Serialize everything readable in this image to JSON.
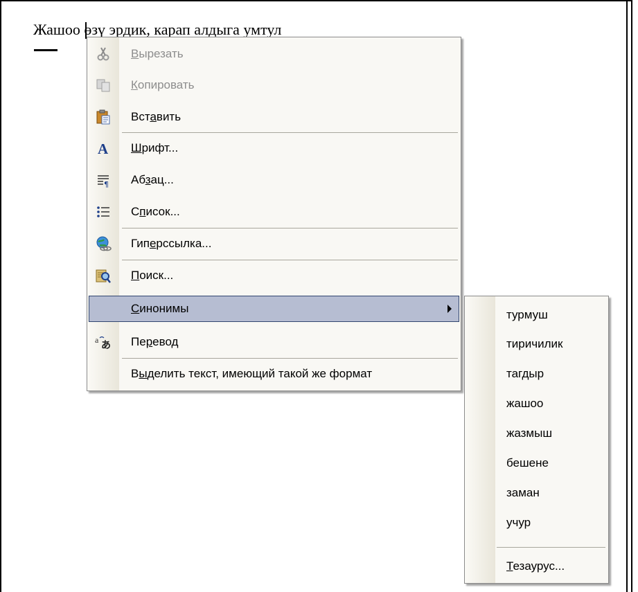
{
  "document": {
    "text": "Жашоо өзү эрдик, карап алдыга умтул"
  },
  "context_menu": {
    "items": [
      {
        "label_pre": "",
        "label_u": "В",
        "label_post": "ырезать",
        "icon": "scissors-icon",
        "disabled": true
      },
      {
        "label_pre": "",
        "label_u": "К",
        "label_post": "опировать",
        "icon": "copy-icon",
        "disabled": true
      },
      {
        "label_pre": "Вст",
        "label_u": "а",
        "label_post": "вить",
        "icon": "paste-icon",
        "disabled": false
      },
      {
        "label_pre": "",
        "label_u": "Ш",
        "label_post": "рифт...",
        "icon": "font-icon",
        "disabled": false
      },
      {
        "label_pre": "Аб",
        "label_u": "з",
        "label_post": "ац...",
        "icon": "paragraph-icon",
        "disabled": false
      },
      {
        "label_pre": "С",
        "label_u": "п",
        "label_post": "исок...",
        "icon": "list-icon",
        "disabled": false
      },
      {
        "label_pre": "Гип",
        "label_u": "е",
        "label_post": "рссылка...",
        "icon": "hyperlink-icon",
        "disabled": false
      },
      {
        "label_pre": "",
        "label_u": "П",
        "label_post": "оиск...",
        "icon": "search-icon",
        "disabled": false
      },
      {
        "label_pre": "",
        "label_u": "С",
        "label_post": "инонимы",
        "icon": "",
        "disabled": false
      },
      {
        "label_pre": "Пе",
        "label_u": "р",
        "label_post": "евод",
        "icon": "translate-icon",
        "disabled": false
      },
      {
        "label_pre": "В",
        "label_u": "ы",
        "label_post": "делить текст, имеющий такой же формат",
        "icon": "",
        "disabled": false
      }
    ]
  },
  "synonyms_menu": {
    "items": [
      "турмуш",
      "тиричилик",
      "тагдыр",
      "жашоо",
      "жазмыш",
      "бешене",
      "заман",
      "учур"
    ],
    "thesaurus": {
      "label_u": "Т",
      "label_post": "езаурус..."
    }
  },
  "colors": {
    "highlight": "#b6bdd2",
    "highlight_border": "#31456f",
    "menu_bg": "#f9f8f4",
    "disabled_text": "#8d8d8d"
  }
}
